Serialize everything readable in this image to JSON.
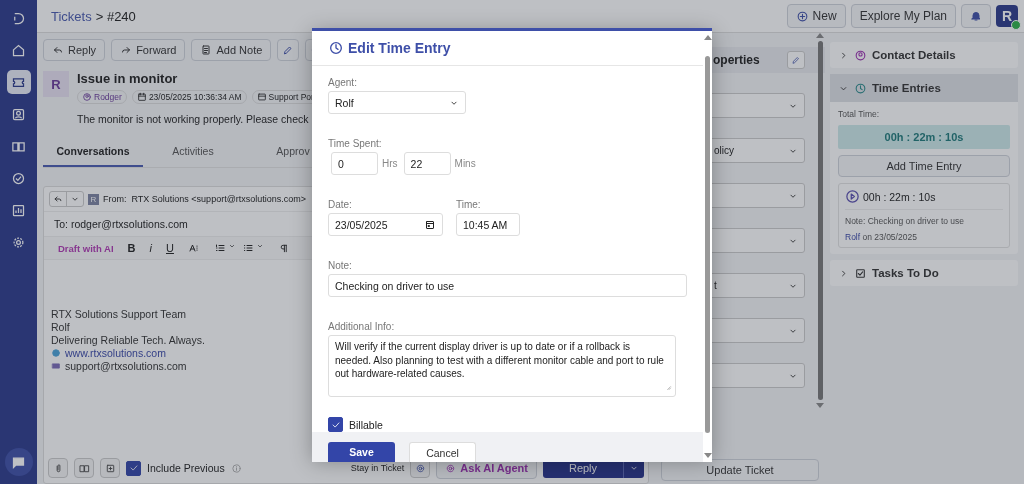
{
  "nav": [
    {
      "kind": "logo",
      "selected": false
    },
    {
      "kind": "home",
      "selected": false
    },
    {
      "kind": "ticket",
      "selected": true
    },
    {
      "kind": "contact",
      "selected": false
    },
    {
      "kind": "book",
      "selected": false
    },
    {
      "kind": "check",
      "selected": false
    },
    {
      "kind": "report",
      "selected": false
    },
    {
      "kind": "settings",
      "selected": false
    },
    {
      "kind": "chat",
      "selected": false
    }
  ],
  "breadcrumb": {
    "link": "Tickets",
    "current": "> #240"
  },
  "header_buttons": [
    {
      "kind": "new",
      "label": "New"
    },
    {
      "kind": "plain",
      "label": "Explore My Plan"
    }
  ],
  "user": {
    "initial": "R",
    "online": true
  },
  "toolbar": [
    {
      "kind": "reply",
      "label": "Reply"
    },
    {
      "kind": "forward",
      "label": "Forward"
    },
    {
      "kind": "note",
      "label": "Add Note"
    },
    {
      "kind": "edit"
    },
    {
      "kind": "share"
    }
  ],
  "ticket": {
    "initial": "R",
    "subject": "Issue in monitor",
    "chips": [
      {
        "kind": "person",
        "label": "Rodger"
      },
      {
        "kind": "date",
        "label": "23/05/2025 10:36:34 AM"
      },
      {
        "kind": "portal",
        "label": "Support Por"
      }
    ],
    "description": "The monitor is not working properly. Please check"
  },
  "tabs": [
    {
      "label": "Conversations",
      "selected": true
    },
    {
      "label": "Activities",
      "selected": false
    },
    {
      "label": "Approv",
      "selected": false
    }
  ],
  "composer": {
    "sender_initial": "R",
    "from": "From:  RTX Solutions <support@rtxsolutions.com>",
    "to": "To: rodger@rtxsolutions.com",
    "draft_ai": "Draft with AI",
    "format": [
      "B",
      "i",
      "U"
    ],
    "signature": [
      "RTX Solutions Support Team",
      "Rolf",
      "Delivering Reliable Tech. Always."
    ],
    "website": "www.rtxsolutions.com",
    "email": "support@rtxsolutions.com",
    "include_previous": {
      "label": "Include Previous",
      "checked": true
    },
    "stay_in_ticket": "Stay in Ticket",
    "ask_ai": "Ask AI Agent",
    "reply": "Reply"
  },
  "properties": {
    "title": "operties",
    "dropdowns": [
      {
        "kind": "select"
      },
      {
        "kind": "select",
        "value": "olicy"
      },
      {
        "kind": "select"
      },
      {
        "kind": "select"
      },
      {
        "kind": "select",
        "value": "t"
      },
      {
        "kind": "select"
      },
      {
        "kind": "select"
      }
    ],
    "update_button": "Update Ticket"
  },
  "sections": [
    {
      "kind": "contact",
      "title": "Contact Details",
      "expanded": false
    },
    {
      "kind": "time",
      "title": "Time Entries",
      "expanded": true,
      "total_label": "Total Time:",
      "total": "00h : 22m : 10s",
      "add_button": "Add Time Entry",
      "entries": [
        {
          "duration": "00h : 22m : 10s",
          "note": "Note: Checking on driver to use",
          "agent": "Rolf",
          "date": "on 23/05/2025"
        }
      ]
    },
    {
      "kind": "tasks",
      "title": "Tasks To Do",
      "expanded": false
    }
  ],
  "modal": {
    "title": "Edit Time Entry",
    "agent_label": "Agent:",
    "agent": "Rolf",
    "time_label": "Time Spent:",
    "hours": "0",
    "hours_unit": "Hrs",
    "minutes": "22",
    "minutes_unit": "Mins",
    "date_label": "Date:",
    "date": "23/05/2025",
    "time_of_day_label": "Time:",
    "time_of_day": "10:45 AM",
    "note_label": "Note:",
    "note": "Checking on driver to use",
    "info_label": "Additional Info:",
    "info": "Will verify if the current display driver is up to date or if a rollback is needed. Also planning to test with a different monitor cable and port to rule out hardware-related causes.",
    "billable": {
      "label": "Billable",
      "checked": true
    },
    "save": "Save",
    "cancel": "Cancel"
  }
}
